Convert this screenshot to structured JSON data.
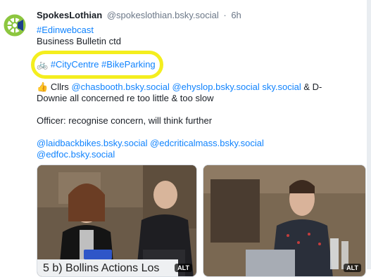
{
  "post": {
    "author_name": "SpokesLothian",
    "handle": "@spokeslothian.bsky.social",
    "separator": "·",
    "time": "6h",
    "hashtag_webcast": "#Edinwebcast",
    "line_business": "Business Bulletin ctd",
    "bike_emoji": "🚲",
    "hashtags_city": "#CityCentre #BikeParking",
    "thumbs_emoji": "👍",
    "cllrs_prefix": "Cllrs",
    "mention_chasbooth": "@chasbooth.bsky.social",
    "mention_ehyslop": "@ehyslop.bsky.social",
    "mention_sky": "sky.social",
    "cllrs_suffix": "& D-",
    "line_downie": "Downie all concerned re too little & too slow",
    "line_officer": "Officer: recognise concern, will think further",
    "mention_laidback": "@laidbackbikes.bsky.social",
    "mention_edcritical": "@edcriticalmass.bsky.social",
    "mention_edfoc": "@edfoc.bsky.social"
  },
  "media": {
    "left_caption": "5 b) Bollins Actions Los",
    "alt_label": "ALT",
    "alt_label_right": "ALT"
  },
  "colors": {
    "link": "#1083fe",
    "highlight": "#f4ee1e",
    "text": "#1a1f26",
    "muted": "#6b7787"
  }
}
